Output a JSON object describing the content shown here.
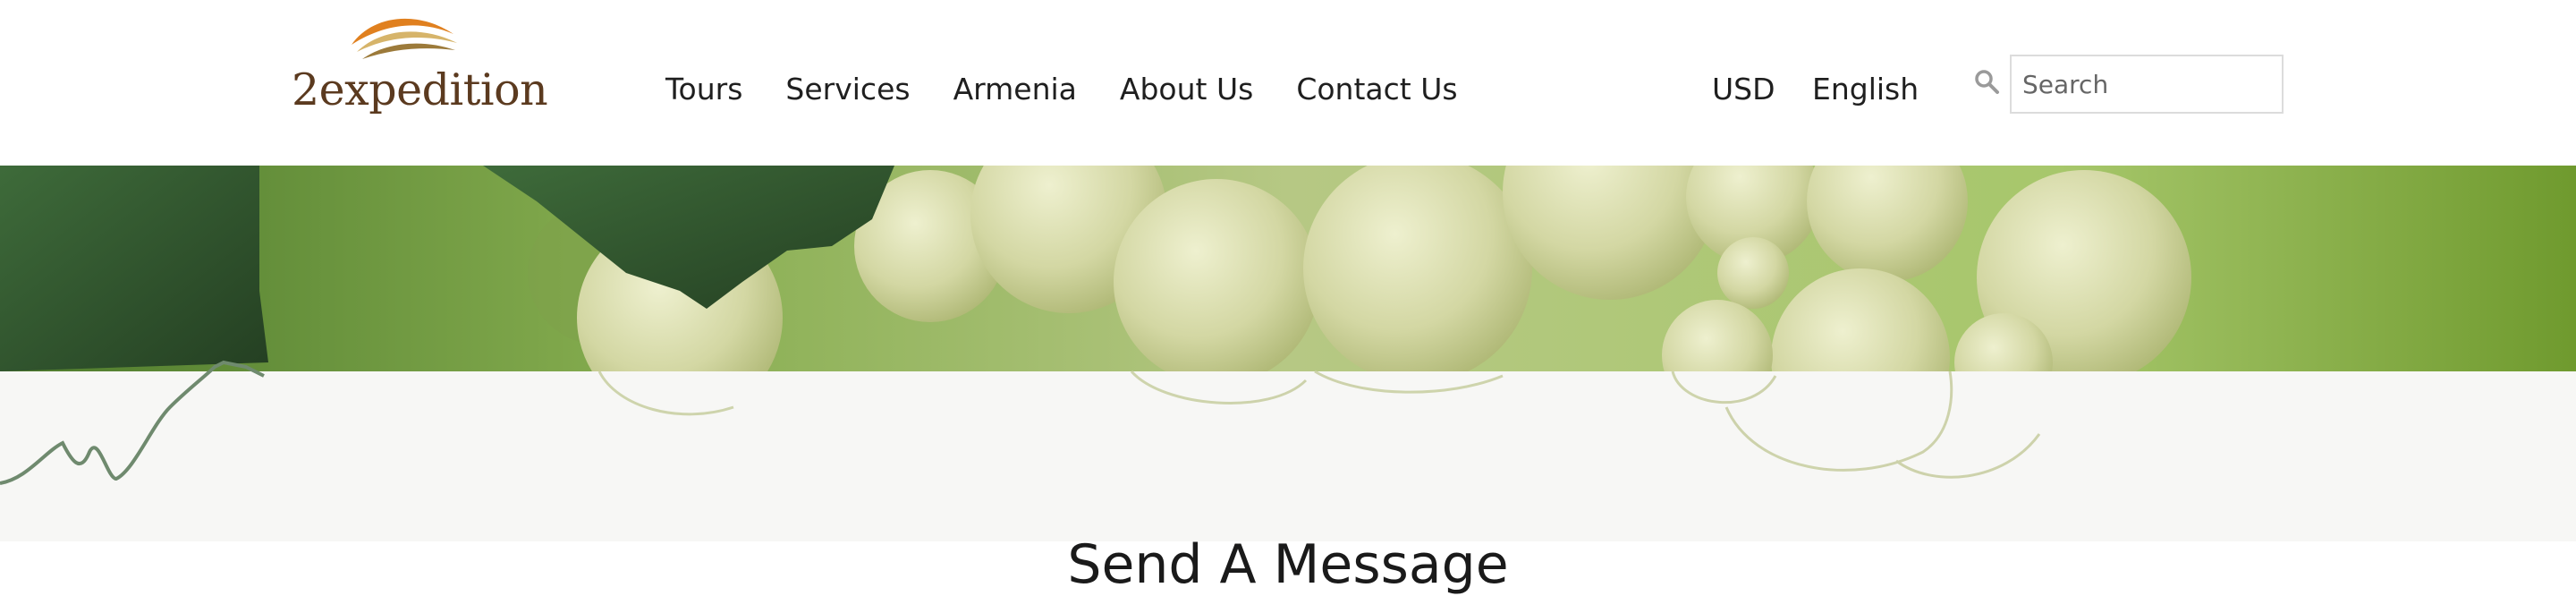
{
  "brand": {
    "name": "2expedition",
    "colors": {
      "text": "#5b3a1f",
      "swoosh_orange": "#e0801f",
      "swoosh_gold": "#d6b46a"
    }
  },
  "nav": {
    "items": [
      {
        "label": "Tours"
      },
      {
        "label": "Services"
      },
      {
        "label": "Armenia"
      },
      {
        "label": "About Us"
      },
      {
        "label": "Contact Us"
      }
    ]
  },
  "header": {
    "currency": "USD",
    "language": "English"
  },
  "search": {
    "placeholder": "Search",
    "icon": "search-icon"
  },
  "banner": {
    "image": "white-grapes-vine-leaves"
  },
  "page": {
    "title": "Send A Message"
  }
}
